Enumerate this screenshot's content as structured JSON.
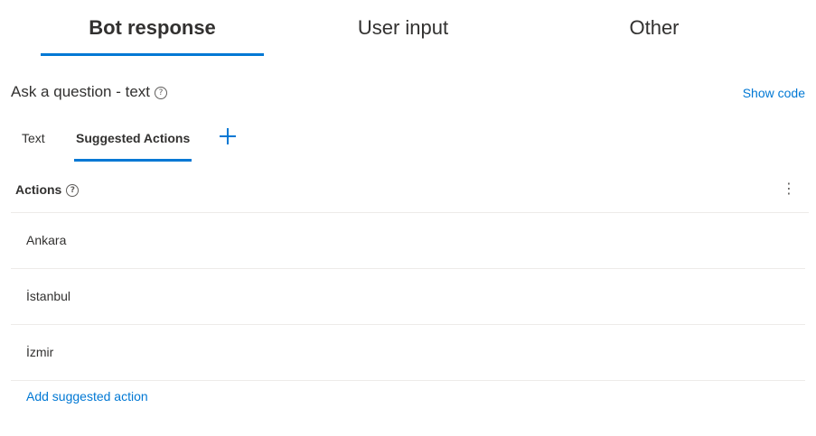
{
  "top_tabs": [
    {
      "label": "Bot response",
      "active": true
    },
    {
      "label": "User input",
      "active": false
    },
    {
      "label": "Other",
      "active": false
    }
  ],
  "prompt": {
    "title": "Ask a question - text",
    "help_icon": "question-circle-icon",
    "show_code": "Show code"
  },
  "sub_tabs": {
    "text": "Text",
    "suggested": "Suggested Actions",
    "add_icon": "plus-icon"
  },
  "actions": {
    "label": "Actions",
    "help_icon": "question-circle-icon",
    "more_icon": "more-vertical-icon",
    "items": [
      "Ankara",
      "İstanbul",
      "İzmir"
    ],
    "add_label": "Add suggested action"
  },
  "colors": {
    "accent": "#0078d4",
    "text": "#323130",
    "divider": "#edebe9"
  }
}
